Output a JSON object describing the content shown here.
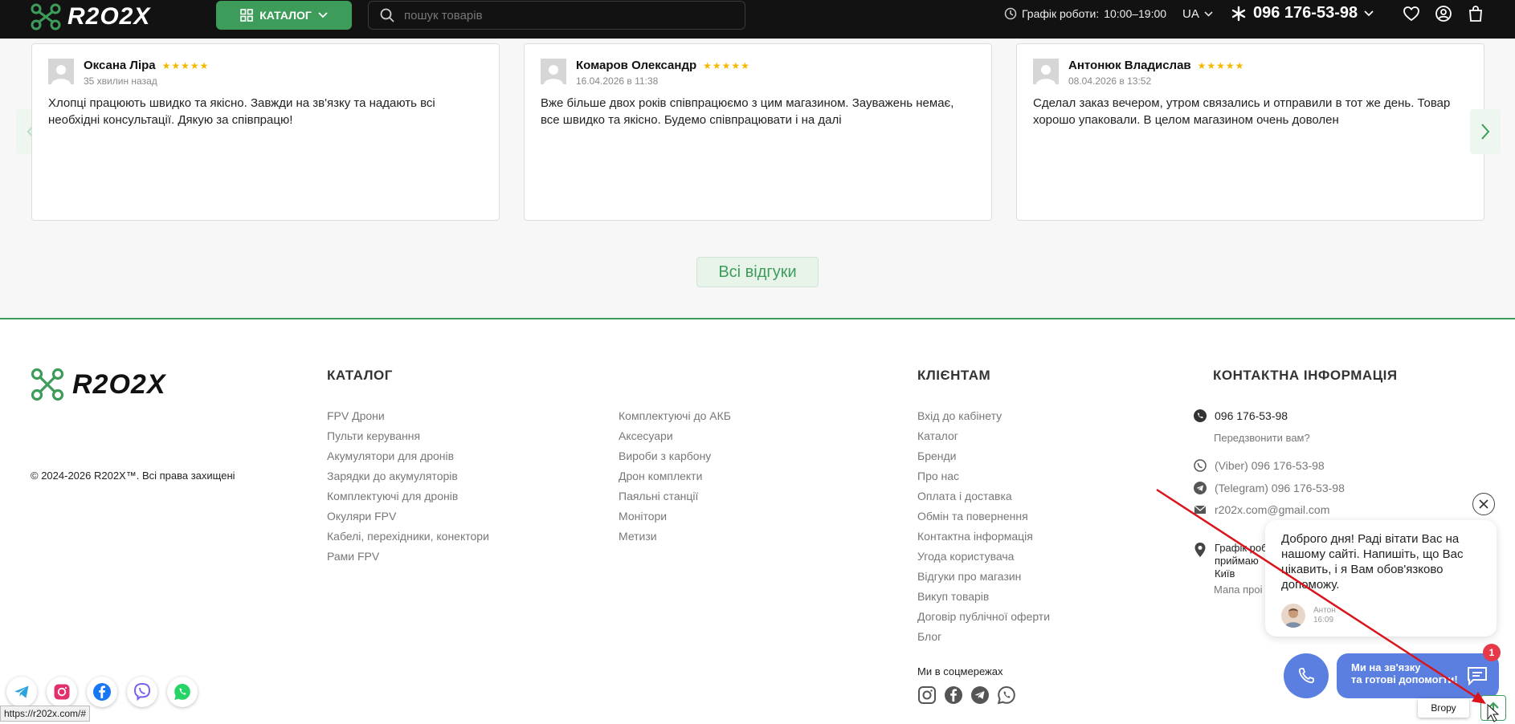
{
  "header": {
    "logo": "R2O2X",
    "catalog_label": "КАТАЛОГ",
    "search_placeholder": "пошук товарів",
    "schedule_label": "Графік роботи:",
    "schedule_value": "10:00–19:00",
    "lang": "UA",
    "phone": "096 176-53-98"
  },
  "reviews": [
    {
      "name": "Оксана Ліра",
      "stars": "★★★★★",
      "date": "35 хвилин назад",
      "text": "Хлопці працюють швидко та якісно. Завжди на зв'язку та надають всі необхідні консультації. Дякую за співпрацю!"
    },
    {
      "name": "Комаров Олександр",
      "stars": "★★★★★",
      "date": "16.04.2026 в 11:38",
      "text": "Вже більше двох років співпрацюємо з цим магазином. Зауважень немає, все швидко та якісно. Будемо співпрацювати і на далі"
    },
    {
      "name": "Антонюк Владислав",
      "stars": "★★★★★",
      "date": "08.04.2026 в 13:52",
      "text": "Сделал заказ вечером, утром связались и отправили в тот же день. Товар хорошо упаковали. В целом магазином очень доволен"
    }
  ],
  "all_reviews_label": "Всі відгуки",
  "footer": {
    "logo": "R2O2X",
    "copyright": "© 2024-2026 R202X™. Всі права захищені",
    "catalog_title": "КАТАЛОГ",
    "catalog_col1": [
      "FPV Дрони",
      "Пульти керування",
      "Акумулятори для дронів",
      "Зарядки до акумуляторів",
      "Комплектуючі для дронів",
      "Окуляри FPV",
      "Кабелі, перехідники, конектори",
      "Рами FPV"
    ],
    "catalog_col2": [
      "Комплектуючі до АКБ",
      "Аксесуари",
      "Вироби з карбону",
      "Дрон комплекти",
      "Паяльні станції",
      "Монітори",
      "Метизи"
    ],
    "clients_title": "КЛІЄНТАМ",
    "clients": [
      "Вхід до кабінету",
      "Каталог",
      "Бренди",
      "Про нас",
      "Оплата і доставка",
      "Обмін та повернення",
      "Контактна інформація",
      "Угода користувача",
      "Відгуки про магазин",
      "Викуп товарів",
      "Договір публічної оферти",
      "Блог"
    ],
    "contacts_title": "КОНТАКТНА ІНФОРМАЦІЯ",
    "contact_phone": "096 176-53-98",
    "callback": "Передзвонити вам?",
    "viber": "(Viber) 096 176-53-98",
    "telegram": "(Telegram) 096 176-53-98",
    "email": "r202x.com@gmail.com",
    "address_lines": [
      "Графік роб",
      "приймаю",
      "Київ"
    ],
    "map_link": "Мапа проі",
    "socials_label": "Ми в соцмережах"
  },
  "status_url": "https://r202x.com/#",
  "chat": {
    "message": "Доброго дня! Раді вітати Вас на нашому сайті. Напишіть, що Вас цікавить, і я Вам обов'язково допоможу.",
    "author": "Антон",
    "time": "16:09",
    "pill_line1": "Ми на зв'язку",
    "pill_line2": "та готові допомогти!",
    "badge": "1",
    "top_tooltip": "Вгору"
  },
  "colors": {
    "accent": "#3e9c5b",
    "header_bg": "#121212",
    "chat_blue": "#5a7fe0",
    "badge_red": "#e63a4a",
    "star": "#f5b800"
  }
}
